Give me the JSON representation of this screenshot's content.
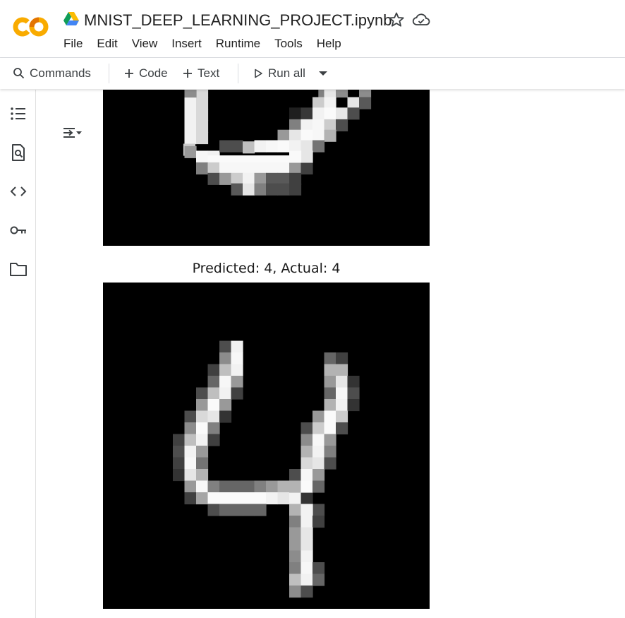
{
  "header": {
    "notebook_title": "MNIST_DEEP_LEARNING_PROJECT.ipynb",
    "menu": [
      "File",
      "Edit",
      "View",
      "Insert",
      "Runtime",
      "Tools",
      "Help"
    ],
    "logo_icon": "colab-logo-icon",
    "drive_icon": "google-drive-icon",
    "star_icon": "star-icon",
    "cloud_icon": "cloud-sync-icon",
    "logo_colors": {
      "orange": "#F9AB00",
      "dark_orange": "#E37400"
    }
  },
  "toolbar": {
    "commands_label": "Commands",
    "code_label": "Code",
    "text_label": "Text",
    "run_all_label": "Run all"
  },
  "sidebar": {
    "items": [
      "table-of-contents-icon",
      "find-replace-icon",
      "code-snippets-icon",
      "secrets-key-icon",
      "files-folder-icon"
    ]
  },
  "output": {
    "toggle_icon": "output-collapse-icon",
    "plots": [
      {
        "caption": ""
      },
      {
        "caption": "Predicted: 4, Actual: 4"
      }
    ]
  }
}
